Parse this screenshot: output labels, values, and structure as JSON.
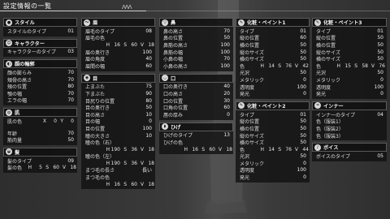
{
  "title": "設定情報の一覧",
  "header_marks": "ΛΛΛ",
  "columns": [
    [
      {
        "id": "style",
        "icon": "silhouette-icon",
        "glyph": "●",
        "title": "スタイル",
        "rows": [
          {
            "label": "スタイルのタイプ",
            "value": "01"
          }
        ]
      },
      {
        "id": "character",
        "icon": "person-icon",
        "glyph": "☺",
        "title": "キャラクター",
        "rows": [
          {
            "label": "キャラクターのタイプ",
            "value": "03"
          }
        ]
      },
      {
        "id": "face-outline",
        "icon": "face-icon",
        "glyph": "◐",
        "title": "顔の輪郭",
        "rows": [
          {
            "label": "顔の膨らみ",
            "value": "70"
          },
          {
            "label": "頬骨の高さ",
            "value": "70"
          },
          {
            "label": "頬の位置",
            "value": "80"
          },
          {
            "label": "顎の幅",
            "value": "70"
          },
          {
            "label": "エラの幅",
            "value": "70"
          }
        ]
      },
      {
        "id": "skin",
        "icon": "skin-icon",
        "glyph": "◍",
        "title": "肌",
        "rows": [
          {
            "label": "肌の色",
            "color": [
              "X",
              "0",
              "Y",
              "0"
            ]
          },
          {
            "gap": true
          },
          {
            "label": "年齢",
            "value": "70"
          },
          {
            "label": "筋肉量",
            "value": "50"
          }
        ]
      },
      {
        "id": "hair",
        "icon": "hair-icon",
        "glyph": "◒",
        "title": "髪",
        "rows": [
          {
            "label": "髪のタイプ",
            "value": "09"
          },
          {
            "label": "髪の色",
            "color": [
              "H",
              "5",
              "S",
              "60",
              "V",
              "18"
            ]
          }
        ]
      }
    ],
    [
      {
        "id": "eyebrow",
        "icon": "eyebrow-icon",
        "glyph": "〜",
        "title": "眉",
        "rows": [
          {
            "label": "眉毛のタイプ",
            "value": "08"
          },
          {
            "label": "眉毛の色",
            "value": ""
          },
          {
            "label": "",
            "color": [
              "H",
              "16",
              "S",
              "60",
              "V",
              "18"
            ]
          },
          {
            "label": "眉の奥行き",
            "value": "100"
          },
          {
            "label": "眉の角度",
            "value": "40"
          },
          {
            "label": "眉間の幅",
            "value": "60"
          }
        ]
      },
      {
        "id": "eye",
        "icon": "eye-icon",
        "glyph": "◉",
        "title": "目",
        "rows": [
          {
            "label": "上まぶた",
            "value": "75"
          },
          {
            "label": "下まぶた",
            "value": "90"
          },
          {
            "label": "目尻りの位置",
            "value": "80"
          },
          {
            "label": "目の奥行き",
            "value": "50"
          },
          {
            "label": "目の高さ",
            "value": "10"
          },
          {
            "label": "目の幅",
            "value": "0"
          },
          {
            "label": "目の位置",
            "value": "100"
          },
          {
            "label": "瞳の大きさ",
            "value": "10"
          },
          {
            "label": "瞳の色（右）",
            "value": ""
          },
          {
            "label": "",
            "color": [
              "H",
              "190",
              "S",
              "36",
              "V",
              "18"
            ]
          },
          {
            "label": "瞳の色（左）",
            "value": ""
          },
          {
            "label": "",
            "color": [
              "H",
              "190",
              "S",
              "36",
              "V",
              "18"
            ]
          },
          {
            "label": "まつ毛の長さ",
            "value": "長い"
          },
          {
            "label": "まつ毛の色",
            "value": ""
          },
          {
            "label": "",
            "color": [
              "H",
              "16",
              "S",
              "60",
              "V",
              "18"
            ]
          }
        ]
      }
    ],
    [
      {
        "id": "nose",
        "icon": "nose-icon",
        "glyph": "▽",
        "title": "鼻",
        "rows": [
          {
            "label": "鼻の高さ",
            "value": "70"
          },
          {
            "label": "鼻の位置",
            "value": "50"
          },
          {
            "label": "鼻筋の高さ",
            "value": "100"
          },
          {
            "label": "鼻筋の幅",
            "value": "100"
          },
          {
            "label": "小鼻の幅",
            "value": "70"
          },
          {
            "label": "小鼻の高さ",
            "value": "100"
          }
        ]
      },
      {
        "id": "mouth",
        "icon": "mouth-icon",
        "glyph": "◡",
        "title": "口",
        "rows": [
          {
            "label": "口の奥行き",
            "value": "40"
          },
          {
            "label": "口の高さ",
            "value": "20"
          },
          {
            "label": "口の位置",
            "value": "30"
          },
          {
            "label": "口角の位置",
            "value": "60"
          },
          {
            "label": "唇の厚み",
            "value": "0"
          }
        ]
      },
      {
        "id": "beard",
        "icon": "beard-icon",
        "glyph": "◗",
        "title": "ひげ",
        "rows": [
          {
            "label": "ひげのタイプ",
            "value": "13"
          },
          {
            "label": "ひげの色",
            "value": ""
          },
          {
            "label": "",
            "color": [
              "H",
              "16",
              "S",
              "60",
              "V",
              "18"
            ]
          }
        ]
      }
    ],
    [
      {
        "id": "makeup1",
        "icon": "paint-icon",
        "glyph": "✎",
        "title": "化粧・ペイント1",
        "rows": [
          {
            "label": "タイプ",
            "value": "01"
          },
          {
            "label": "縦の位置",
            "value": "60"
          },
          {
            "label": "横の位置",
            "value": "50"
          },
          {
            "label": "縦のサイズ",
            "value": "50"
          },
          {
            "label": "横のサイズ",
            "value": "50"
          },
          {
            "label": "色",
            "color": [
              "H",
              "14",
              "S",
              "76",
              "V",
              "42"
            ]
          },
          {
            "label": "光沢",
            "value": "50"
          },
          {
            "label": "メタリック",
            "value": "0"
          },
          {
            "label": "透明度",
            "value": "100"
          },
          {
            "label": "発光",
            "value": "0"
          }
        ]
      },
      {
        "id": "makeup2",
        "icon": "paint-icon",
        "glyph": "✎",
        "title": "化粧・ペイント2",
        "rows": [
          {
            "label": "タイプ",
            "value": "01"
          },
          {
            "label": "縦の位置",
            "value": "50"
          },
          {
            "label": "横の位置",
            "value": "50"
          },
          {
            "label": "縦のサイズ",
            "value": "50"
          },
          {
            "label": "横のサイズ",
            "value": "50"
          },
          {
            "label": "色",
            "color": [
              "H",
              "14",
              "S",
              "76",
              "V",
              "44"
            ]
          },
          {
            "label": "光沢",
            "value": "50"
          },
          {
            "label": "メタリック",
            "value": "0"
          },
          {
            "label": "透明度",
            "value": "100"
          },
          {
            "label": "発光",
            "value": "0"
          }
        ]
      }
    ],
    [
      {
        "id": "makeup3",
        "icon": "paint-icon",
        "glyph": "✎",
        "title": "化粧・ペイント3",
        "rows": [
          {
            "label": "タイプ",
            "value": "01"
          },
          {
            "label": "縦の位置",
            "value": "50"
          },
          {
            "label": "横の位置",
            "value": "50"
          },
          {
            "label": "縦のサイズ",
            "value": "50"
          },
          {
            "label": "横のサイズ",
            "value": "50"
          },
          {
            "label": "色",
            "color": [
              "H",
              "15",
              "S",
              "58",
              "V",
              "76"
            ]
          },
          {
            "label": "光沢",
            "value": "50"
          },
          {
            "label": "メタリック",
            "value": "0"
          },
          {
            "label": "透明度",
            "value": "100"
          },
          {
            "label": "発光",
            "value": "0"
          }
        ]
      },
      {
        "id": "inner",
        "icon": "shirt-icon",
        "glyph": "♒",
        "title": "インナー",
        "rows": [
          {
            "label": "インナーのタイプ",
            "value": "04"
          },
          {
            "label": "色（服装1）",
            "value": ""
          },
          {
            "label": "色（服装2）",
            "value": ""
          },
          {
            "label": "色（服装3）",
            "value": ""
          }
        ]
      },
      {
        "id": "voice",
        "icon": "voice-icon",
        "glyph": "♪",
        "title": "ボイス",
        "rows": [
          {
            "label": "ボイスのタイプ",
            "value": "05"
          }
        ]
      }
    ]
  ]
}
